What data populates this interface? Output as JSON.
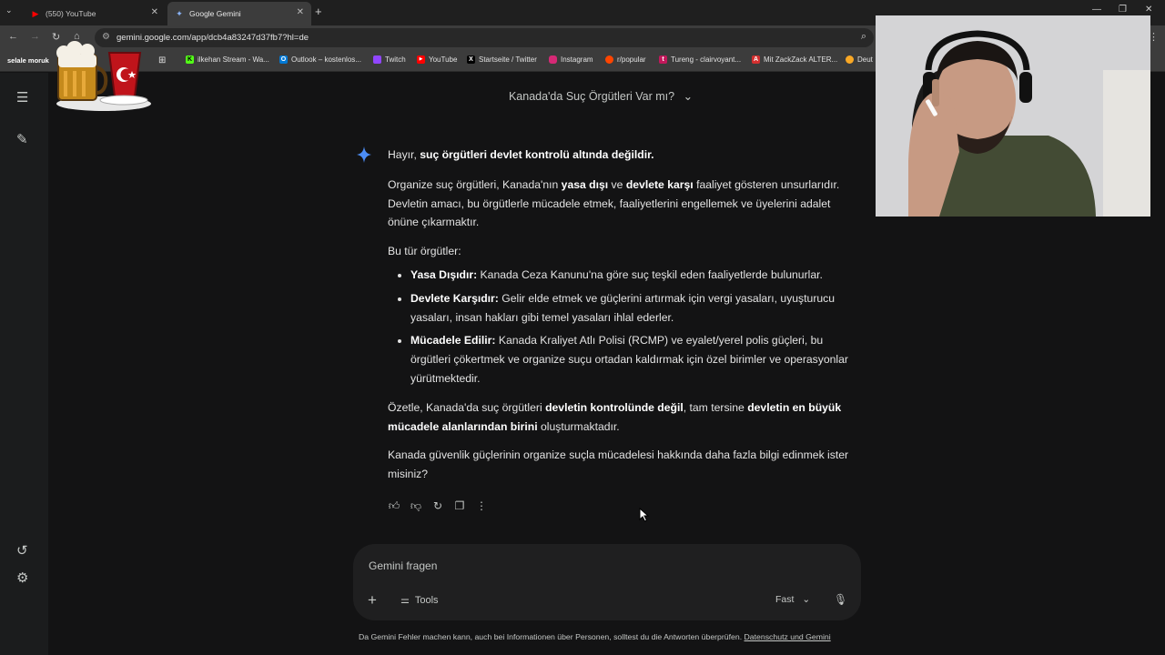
{
  "browser": {
    "tabs": [
      {
        "title": "(550) YouTube",
        "active": false
      },
      {
        "title": "Google Gemini",
        "active": true
      }
    ],
    "url": "gemini.google.com/app/dcb4a83247d37fb7?hl=de",
    "bookmarks": [
      {
        "label": "selale moruk"
      },
      {
        "label": "ilkehan Stream - Wa...",
        "icon_color": "#53fc18",
        "icon": "K"
      },
      {
        "label": "Outlook – kostenlos...",
        "icon_color": "#0078d4",
        "icon": "O"
      },
      {
        "label": "Twitch",
        "icon_color": "#9146ff",
        "icon": ""
      },
      {
        "label": "YouTube",
        "icon_color": "#ff0000",
        "icon": "▶"
      },
      {
        "label": "Startseite / Twitter",
        "icon_color": "#000000",
        "icon": "X"
      },
      {
        "label": "Instagram",
        "icon_color": "#d62976",
        "icon": ""
      },
      {
        "label": "r/popular",
        "icon_color": "#ff4500",
        "icon": ""
      },
      {
        "label": "Tureng - clairvoyant...",
        "icon_color": "#c2185b",
        "icon": "t"
      },
      {
        "label": "Mit ZackZack ALTER...",
        "icon_color": "#d32f2f",
        "icon": "A"
      },
      {
        "label": "Deut",
        "icon_color": "#f9a825",
        "icon": ""
      }
    ]
  },
  "chat": {
    "title": "Kanada'da Suç Örgütleri Var mı?",
    "intro_prefix": "Hayır, ",
    "intro_bold": "suç örgütleri devlet kontrolü altında değildir.",
    "p1": {
      "a": "Organize suç örgütleri, Kanada'nın ",
      "b1": "yasa dışı",
      "c": " ve ",
      "b2": "devlete karşı",
      "d": " faaliyet gösteren unsurlarıdır. Devletin amacı, bu örgütlerle mücadele etmek, faaliyetlerini engellemek ve üyelerini adalet önüne çıkarmaktır."
    },
    "list_intro": "Bu tür örgütler:",
    "bullets": [
      {
        "term": "Yasa Dışıdır:",
        "text": " Kanada Ceza Kanunu'na göre suç teşkil eden faaliyetlerde bulunurlar."
      },
      {
        "term": "Devlete Karşıdır:",
        "text": " Gelir elde etmek ve güçlerini artırmak için vergi yasaları, uyuşturucu yasaları, insan hakları gibi temel yasaları ihlal ederler."
      },
      {
        "term": "Mücadele Edilir:",
        "text": " Kanada Kraliyet Atlı Polisi (RCMP) ve eyalet/yerel polis güçleri, bu örgütleri çökertmek ve organize suçu ortadan kaldırmak için özel birimler ve operasyonlar yürütmektedir."
      }
    ],
    "summary": {
      "a": "Özetle, Kanada'da suç örgütleri ",
      "b1": "devletin kontrolünde değil",
      "c": ", tam tersine ",
      "b2": "devletin en büyük mücadele alanlarından birini",
      "d": " oluşturmaktadır."
    },
    "closing": "Kanada güvenlik güçlerinin organize suçla mücadelesi hakkında daha fazla bilgi edinmek ister misiniz?"
  },
  "composer": {
    "placeholder": "Gemini fragen",
    "tools_label": "Tools",
    "model_label": "Fast"
  },
  "footer": {
    "disclaimer": "Da Gemini Fehler machen kann, auch bei Informationen über Personen, solltest du die Antworten überprüfen. ",
    "link": "Datenschutz und Gemini"
  },
  "colors": {
    "background": "#131314",
    "sidebar": "#1b1c1d",
    "composer": "#1f1f20",
    "gemini_spark": "#4c8df6"
  }
}
